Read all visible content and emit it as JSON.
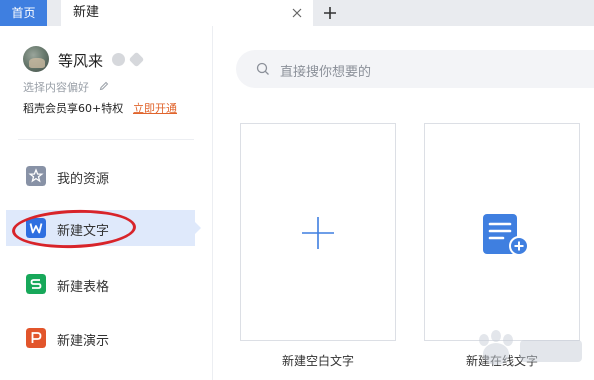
{
  "tabs": {
    "home_label": "首页",
    "new_label": "新建"
  },
  "user": {
    "name": "等风来",
    "preference_text": "选择内容偏好",
    "vip_text": "稻壳会员享60+特权",
    "vip_link": "立即开通"
  },
  "sidebar": {
    "items": [
      {
        "label": "我的资源",
        "icon": "star-icon",
        "color": "#8892a6"
      },
      {
        "label": "新建文字",
        "icon": "word-icon",
        "color": "#2f6fe0",
        "active": true
      },
      {
        "label": "新建表格",
        "icon": "sheet-icon",
        "color": "#17a85a"
      },
      {
        "label": "新建演示",
        "icon": "presentation-icon",
        "color": "#e2552b"
      }
    ]
  },
  "search": {
    "placeholder": "直接搜你想要的"
  },
  "cards": [
    {
      "label": "新建空白文字",
      "icon": "plus-icon"
    },
    {
      "label": "新建在线文字",
      "icon": "online-doc-icon"
    }
  ],
  "colors": {
    "accent": "#3f7fe0",
    "active_bg": "#dfe9fb",
    "annotation": "#d8242a",
    "link": "#e0642c"
  }
}
